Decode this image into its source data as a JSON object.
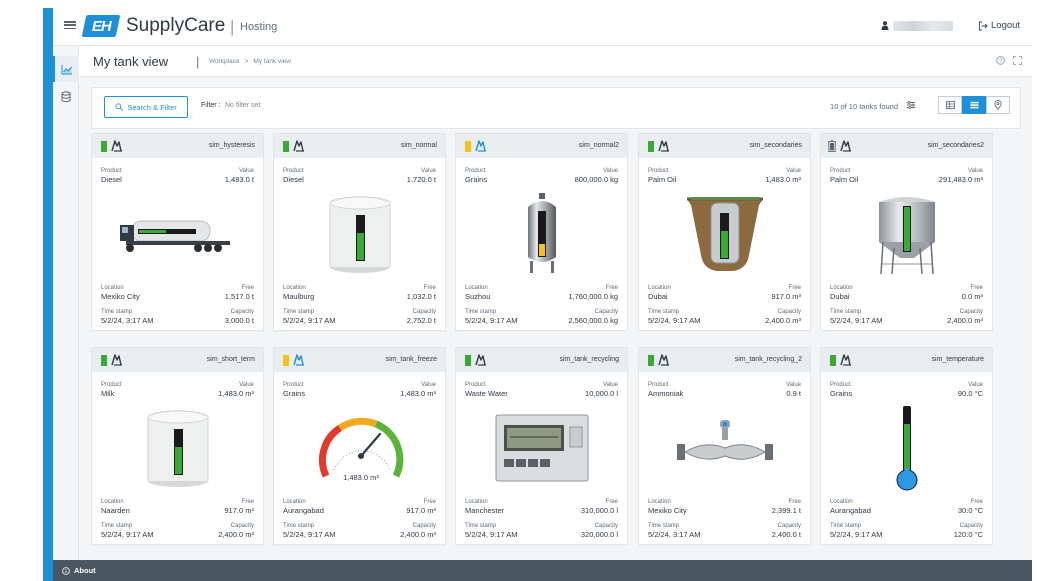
{
  "app": {
    "brand": "EH",
    "name": "SupplyCare",
    "separator": "|",
    "subtitle": "Hosting"
  },
  "header": {
    "logout_label": "Logout"
  },
  "page": {
    "title": "My tank view",
    "title_sep": "|",
    "breadcrumb": [
      "Workplace",
      ">",
      "My tank view"
    ]
  },
  "filter": {
    "search_label": "Search & Filter",
    "filter_label": "Filter :",
    "filter_value": "No filter set",
    "found": "10 of 10 tanks found"
  },
  "labels": {
    "product": "Product",
    "value": "Value",
    "location": "Location",
    "free": "Free",
    "timestamp": "Time stamp",
    "capacity": "Capacity"
  },
  "colors": {
    "accent": "#1e90d8",
    "status_green": "#3aa935",
    "status_yellow": "#f5c218",
    "footer": "#4a5661"
  },
  "tanks": [
    {
      "name": "sim_hysteresis",
      "status": "green",
      "icon": "level-device-icon",
      "product": "Diesel",
      "value": "1,483.0 t",
      "location": "Mexiko City",
      "free": "1,517.0 t",
      "timestamp": "5/2/24, 3:17 AM",
      "capacity": "3,000.0 t",
      "visual": "truck",
      "fill": 0.49
    },
    {
      "name": "sim_normal",
      "status": "green",
      "icon": "level-device-icon",
      "product": "Diesel",
      "value": "1,720.0 t",
      "location": "Maulburg",
      "free": "1,032.0 t",
      "timestamp": "5/2/24, 9:17 AM",
      "capacity": "2,752.0 t",
      "visual": "silo-round",
      "fill": 0.62
    },
    {
      "name": "sim_normal2",
      "status": "yellow",
      "icon": "level-device-icon",
      "product": "Grains",
      "value": "800,000.0 kg",
      "location": "Suzhou",
      "free": "1,760,000.0 kg",
      "timestamp": "5/2/24, 9:17 AM",
      "capacity": "2,560,000.0 kg",
      "visual": "steel-vessel",
      "fill": 0.31
    },
    {
      "name": "sim_secondaries",
      "status": "green",
      "icon": "level-device-icon",
      "product": "Palm Oil",
      "value": "1,483.0 m³",
      "location": "Dubai",
      "free": "917.0 m³",
      "timestamp": "5/2/24, 9:17 AM",
      "capacity": "2,400.0 m³",
      "visual": "underground",
      "fill": 0.62
    },
    {
      "name": "sim_secondaries2",
      "status": "battery",
      "icon": "level-device-icon",
      "product": "Palm Oil",
      "value": "291,483.0 m³",
      "location": "Dubai",
      "free": "0.0 m³",
      "timestamp": "5/2/24, 9:17 AM",
      "capacity": "2,400.0 m³",
      "visual": "silo-legs",
      "fill": 1.0
    },
    {
      "name": "sim_short_term",
      "status": "green",
      "icon": "level-device-icon",
      "product": "Milk",
      "value": "1,483.0 m³",
      "location": "Naarden",
      "free": "917.0 m³",
      "timestamp": "5/2/24, 9:17 AM",
      "capacity": "2,400.0 m³",
      "visual": "silo-round",
      "fill": 0.62
    },
    {
      "name": "sim_tank_freeze",
      "status": "yellow",
      "icon": "level-device-icon",
      "product": "Grains",
      "value": "1,483.0 m³",
      "location": "Aurangabad",
      "free": "917.0 m³",
      "timestamp": "5/2/24, 9:17 AM",
      "capacity": "2,400.0 m³",
      "visual": "gauge",
      "gauge_label": "1,483.0 m³",
      "fill": 0.62
    },
    {
      "name": "sim_tank_recycling",
      "status": "green",
      "icon": "level-device-icon",
      "product": "Waste Water",
      "value": "10,000.0 l",
      "location": "Manchester",
      "free": "310,000.0 l",
      "timestamp": "5/2/24, 9:17 AM",
      "capacity": "320,000.0 l",
      "visual": "controller",
      "fill": 0.03
    },
    {
      "name": "sim_tank_recycling_2",
      "status": "green",
      "icon": "level-device-icon",
      "product": "Ammoniak",
      "value": "0.9 t",
      "location": "Mexiko City",
      "free": "2,399.1 t",
      "timestamp": "5/2/24, 3:17 AM",
      "capacity": "2,400.0 t",
      "visual": "flowmeter",
      "fill": 0.0
    },
    {
      "name": "sim_temperature",
      "status": "green",
      "icon": "level-device-icon",
      "product": "Grains",
      "value": "90.0 °C",
      "location": "Aurangabad",
      "free": "30.0 °C",
      "timestamp": "5/2/24, 9:17 AM",
      "capacity": "120.0 °C",
      "visual": "thermometer",
      "fill": 0.75
    }
  ],
  "footer": {
    "about_label": "About"
  }
}
